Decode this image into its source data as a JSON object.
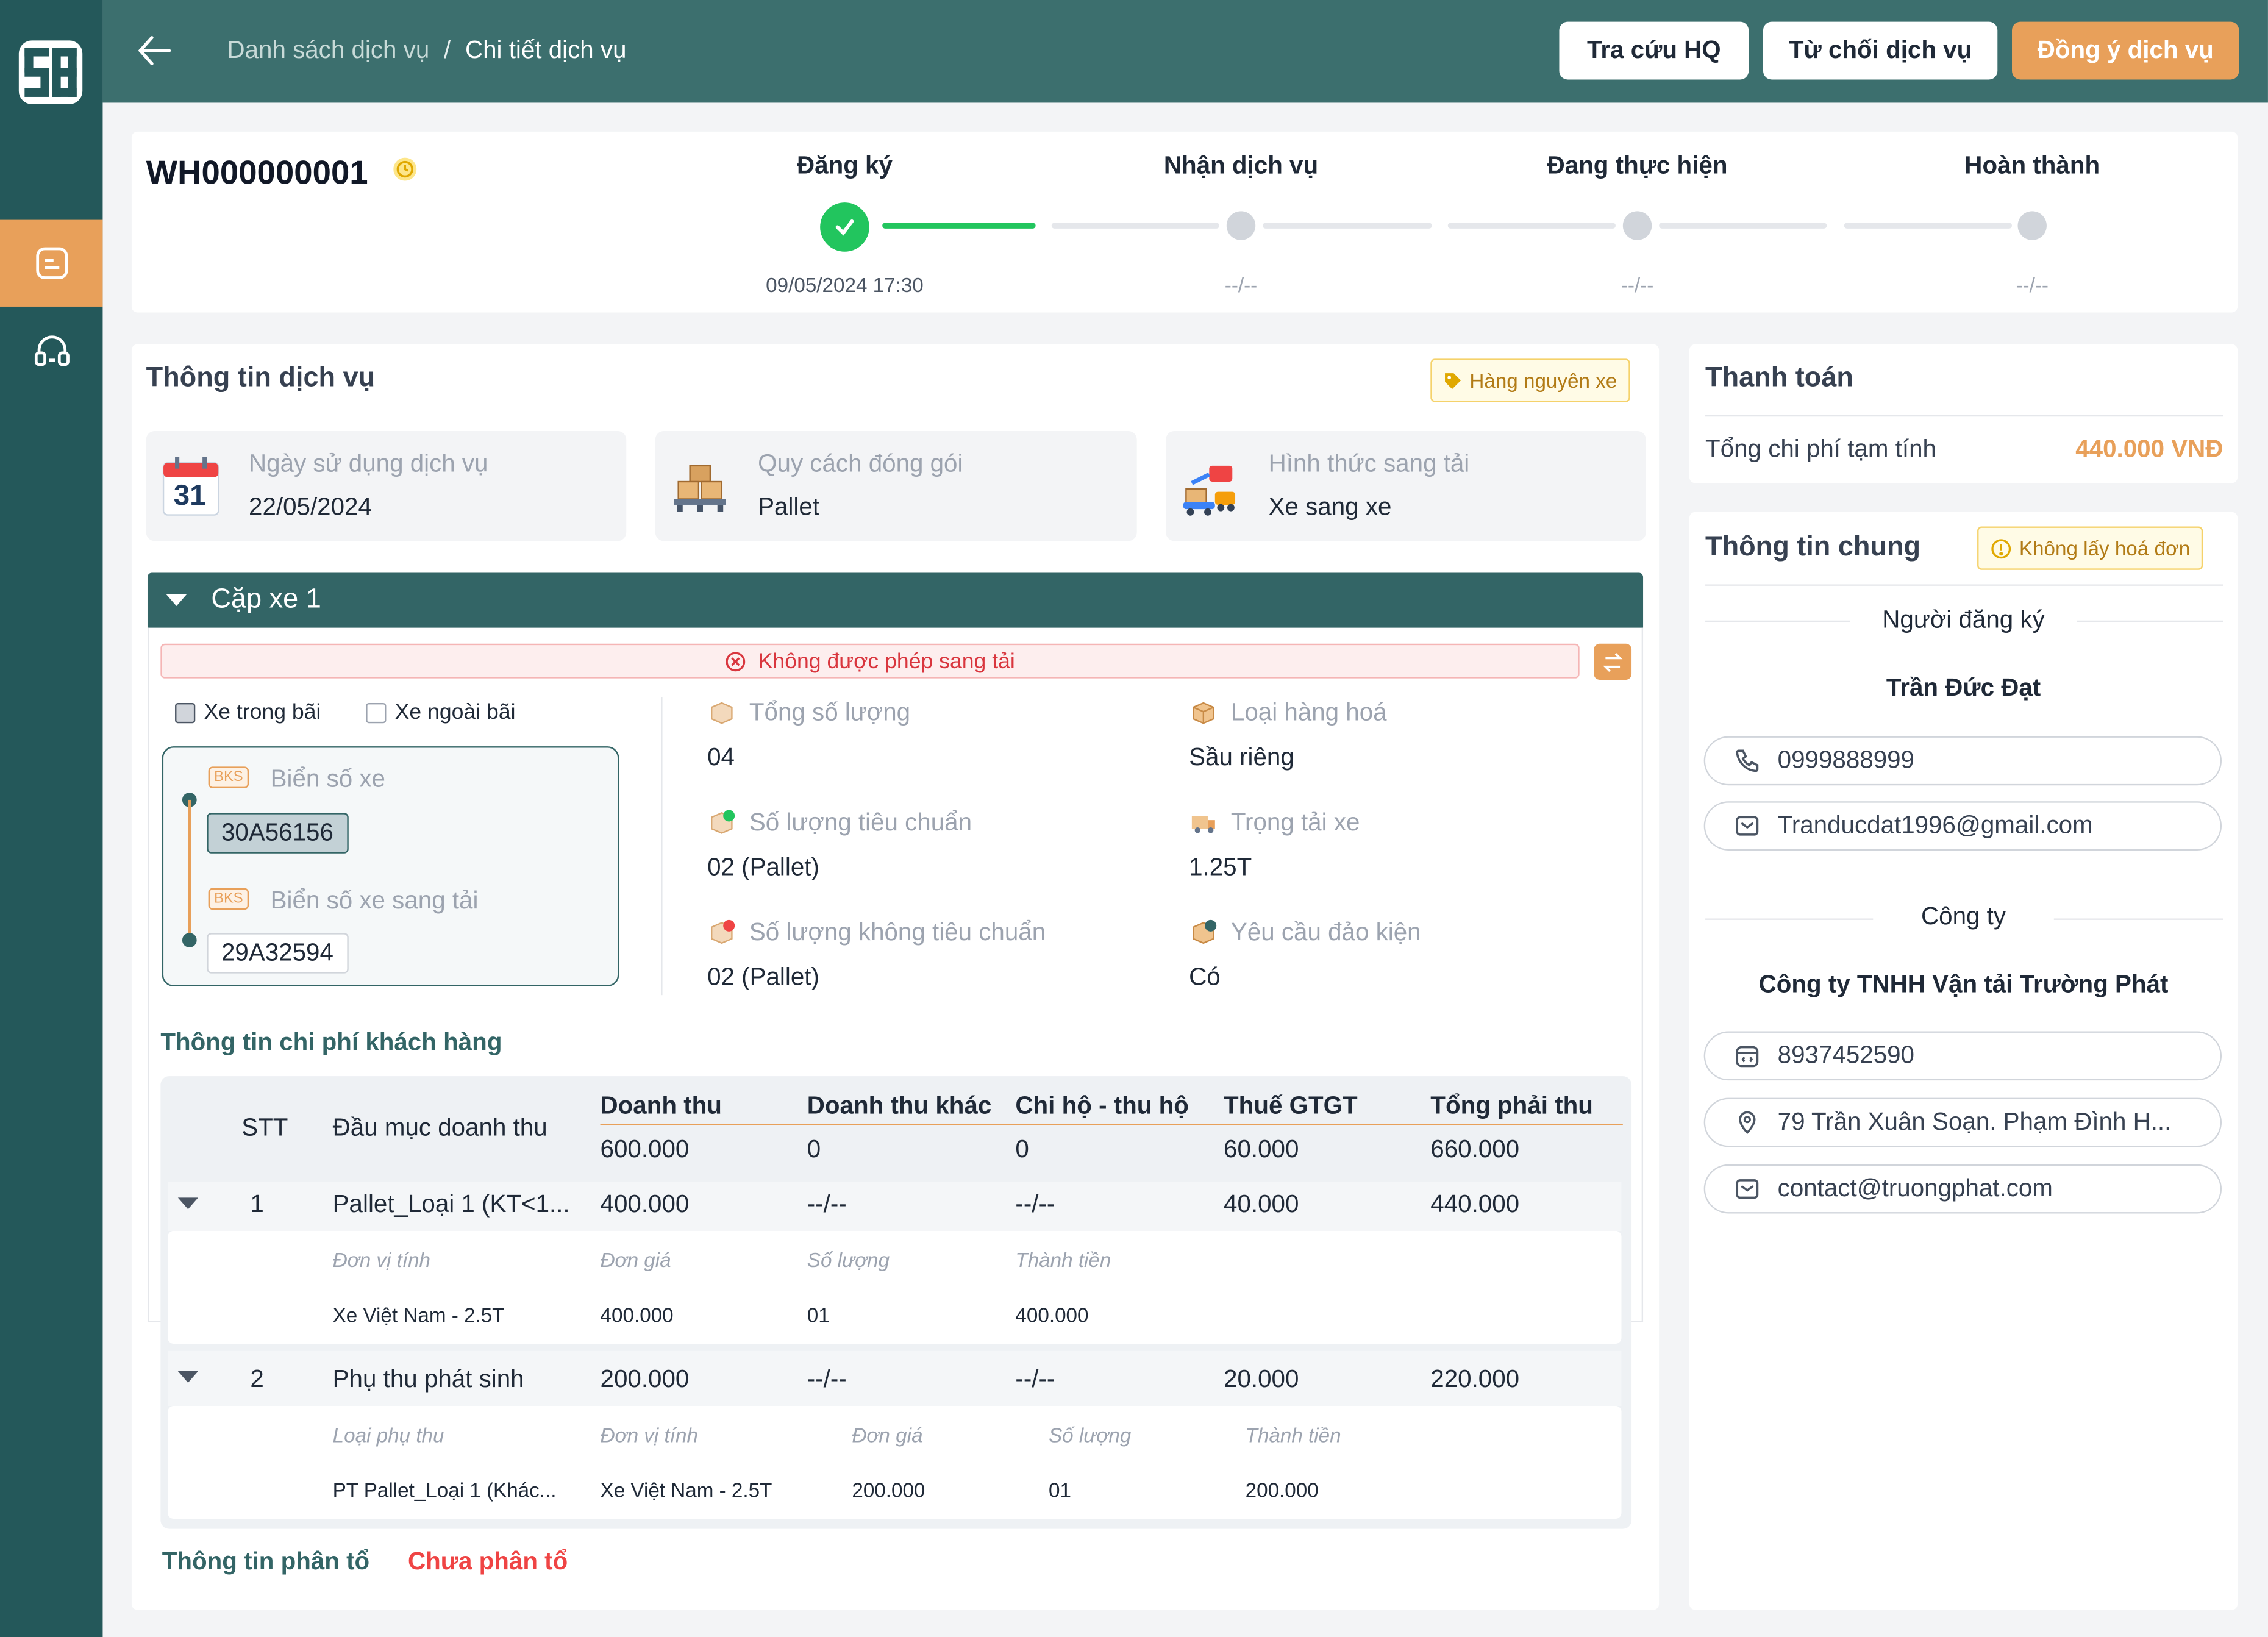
{
  "topbar": {
    "breadcrumb_parent": "Danh sách dịch vụ",
    "breadcrumb_sep": "/",
    "breadcrumb_current": "Chi tiết dịch vụ",
    "btn_lookup": "Tra cứu HQ",
    "btn_reject": "Từ chối dịch vụ",
    "btn_accept": "Đồng ý dịch vụ"
  },
  "order": {
    "code": "WH000000001",
    "steps": [
      {
        "label": "Đăng ký",
        "date": "09/05/2024 17:30",
        "done": true
      },
      {
        "label": "Nhận dịch vụ",
        "date": "--/--",
        "done": false
      },
      {
        "label": "Đang thực hiện",
        "date": "--/--",
        "done": false
      },
      {
        "label": "Hoàn thành",
        "date": "--/--",
        "done": false
      }
    ]
  },
  "service": {
    "title": "Thông tin dịch vụ",
    "tag": "Hàng nguyên xe",
    "boxes": [
      {
        "label": "Ngày sử dụng dịch vụ",
        "value": "22/05/2024",
        "icon": "calendar-icon",
        "icon_text": "31"
      },
      {
        "label": "Quy cách đóng gói",
        "value": "Pallet",
        "icon": "pallet-icon"
      },
      {
        "label": "Hình thức sang tải",
        "value": "Xe sang xe",
        "icon": "truck-transfer-icon"
      }
    ],
    "pair_title": "Cặp xe 1",
    "warning": "Không được phép sang tải",
    "checkbox_in": "Xe trong bãi",
    "checkbox_out": "Xe ngoài bãi",
    "bks_badge": "BKS",
    "plate_label": "Biển số xe",
    "plate_value": "30A56156",
    "transfer_plate_label": "Biển số xe sang tải",
    "transfer_plate_value": "29A32594",
    "fields": [
      {
        "label": "Tổng số lượng",
        "value": "04"
      },
      {
        "label": "Loại hàng hoá",
        "value": "Sầu riêng"
      },
      {
        "label": "Số lượng tiêu chuẩn",
        "value": "02 (Pallet)"
      },
      {
        "label": "Trọng tải xe",
        "value": "1.25T"
      },
      {
        "label": "Số lượng không tiêu chuẩn",
        "value": "02 (Pallet)"
      },
      {
        "label": "Yêu cầu đảo kiện",
        "value": "Có"
      }
    ],
    "cost_title": "Thông tin chi phí khách hàng",
    "table": {
      "headers": [
        "STT",
        "Đầu mục doanh thu",
        "Doanh thu",
        "Doanh thu khác",
        "Chi hộ - thu hộ",
        "Thuế GTGT",
        "Tổng phải thu"
      ],
      "totals": [
        "600.000",
        "0",
        "0",
        "60.000",
        "660.000"
      ],
      "rows": [
        {
          "stt": "1",
          "name": "Pallet_Loại 1 (KT<1...",
          "revenue": "400.000",
          "other": "--/--",
          "collect": "--/--",
          "vat": "40.000",
          "total": "440.000",
          "sub_headers": [
            "Đơn vị tính",
            "Đơn giá",
            "Số lượng",
            "Thành tiền"
          ],
          "sub_values": [
            "Xe Việt Nam - 2.5T",
            "400.000",
            "01",
            "400.000"
          ]
        },
        {
          "stt": "2",
          "name": "Phụ thu phát sinh",
          "revenue": "200.000",
          "other": "--/--",
          "collect": "--/--",
          "vat": "20.000",
          "total": "220.000",
          "sub_headers": [
            "Loại phụ thu",
            "Đơn vị tính",
            "Đơn giá",
            "Số lượng",
            "Thành tiền"
          ],
          "sub_values": [
            "PT Pallet_Loại 1 (Khác...",
            "Xe Việt Nam - 2.5T",
            "200.000",
            "01",
            "200.000"
          ]
        }
      ]
    },
    "group_label": "Thông tin phân tổ",
    "group_status": "Chưa phân tổ"
  },
  "payment": {
    "title": "Thanh toán",
    "total_label": "Tổng chi phí tạm tính",
    "total_value": "440.000 VNĐ"
  },
  "general": {
    "title": "Thông tin chung",
    "tag": "Không lấy hoá đơn",
    "registrant_label": "Người đăng ký",
    "registrant_name": "Trần Đức Đạt",
    "phone": "0999888999",
    "email": "Tranducdat1996@gmail.com",
    "company_label": "Công ty",
    "company_name": "Công ty TNHH Vận tải Trường Phát",
    "tax_code": "8937452590",
    "address": "79 Trần Xuân Soạn. Phạm Đình H...",
    "company_email": "contact@truongphat.com"
  },
  "colors": {
    "primary": "#336566",
    "accent": "#e8a05a",
    "success": "#22c55e",
    "danger": "#d9363e"
  }
}
